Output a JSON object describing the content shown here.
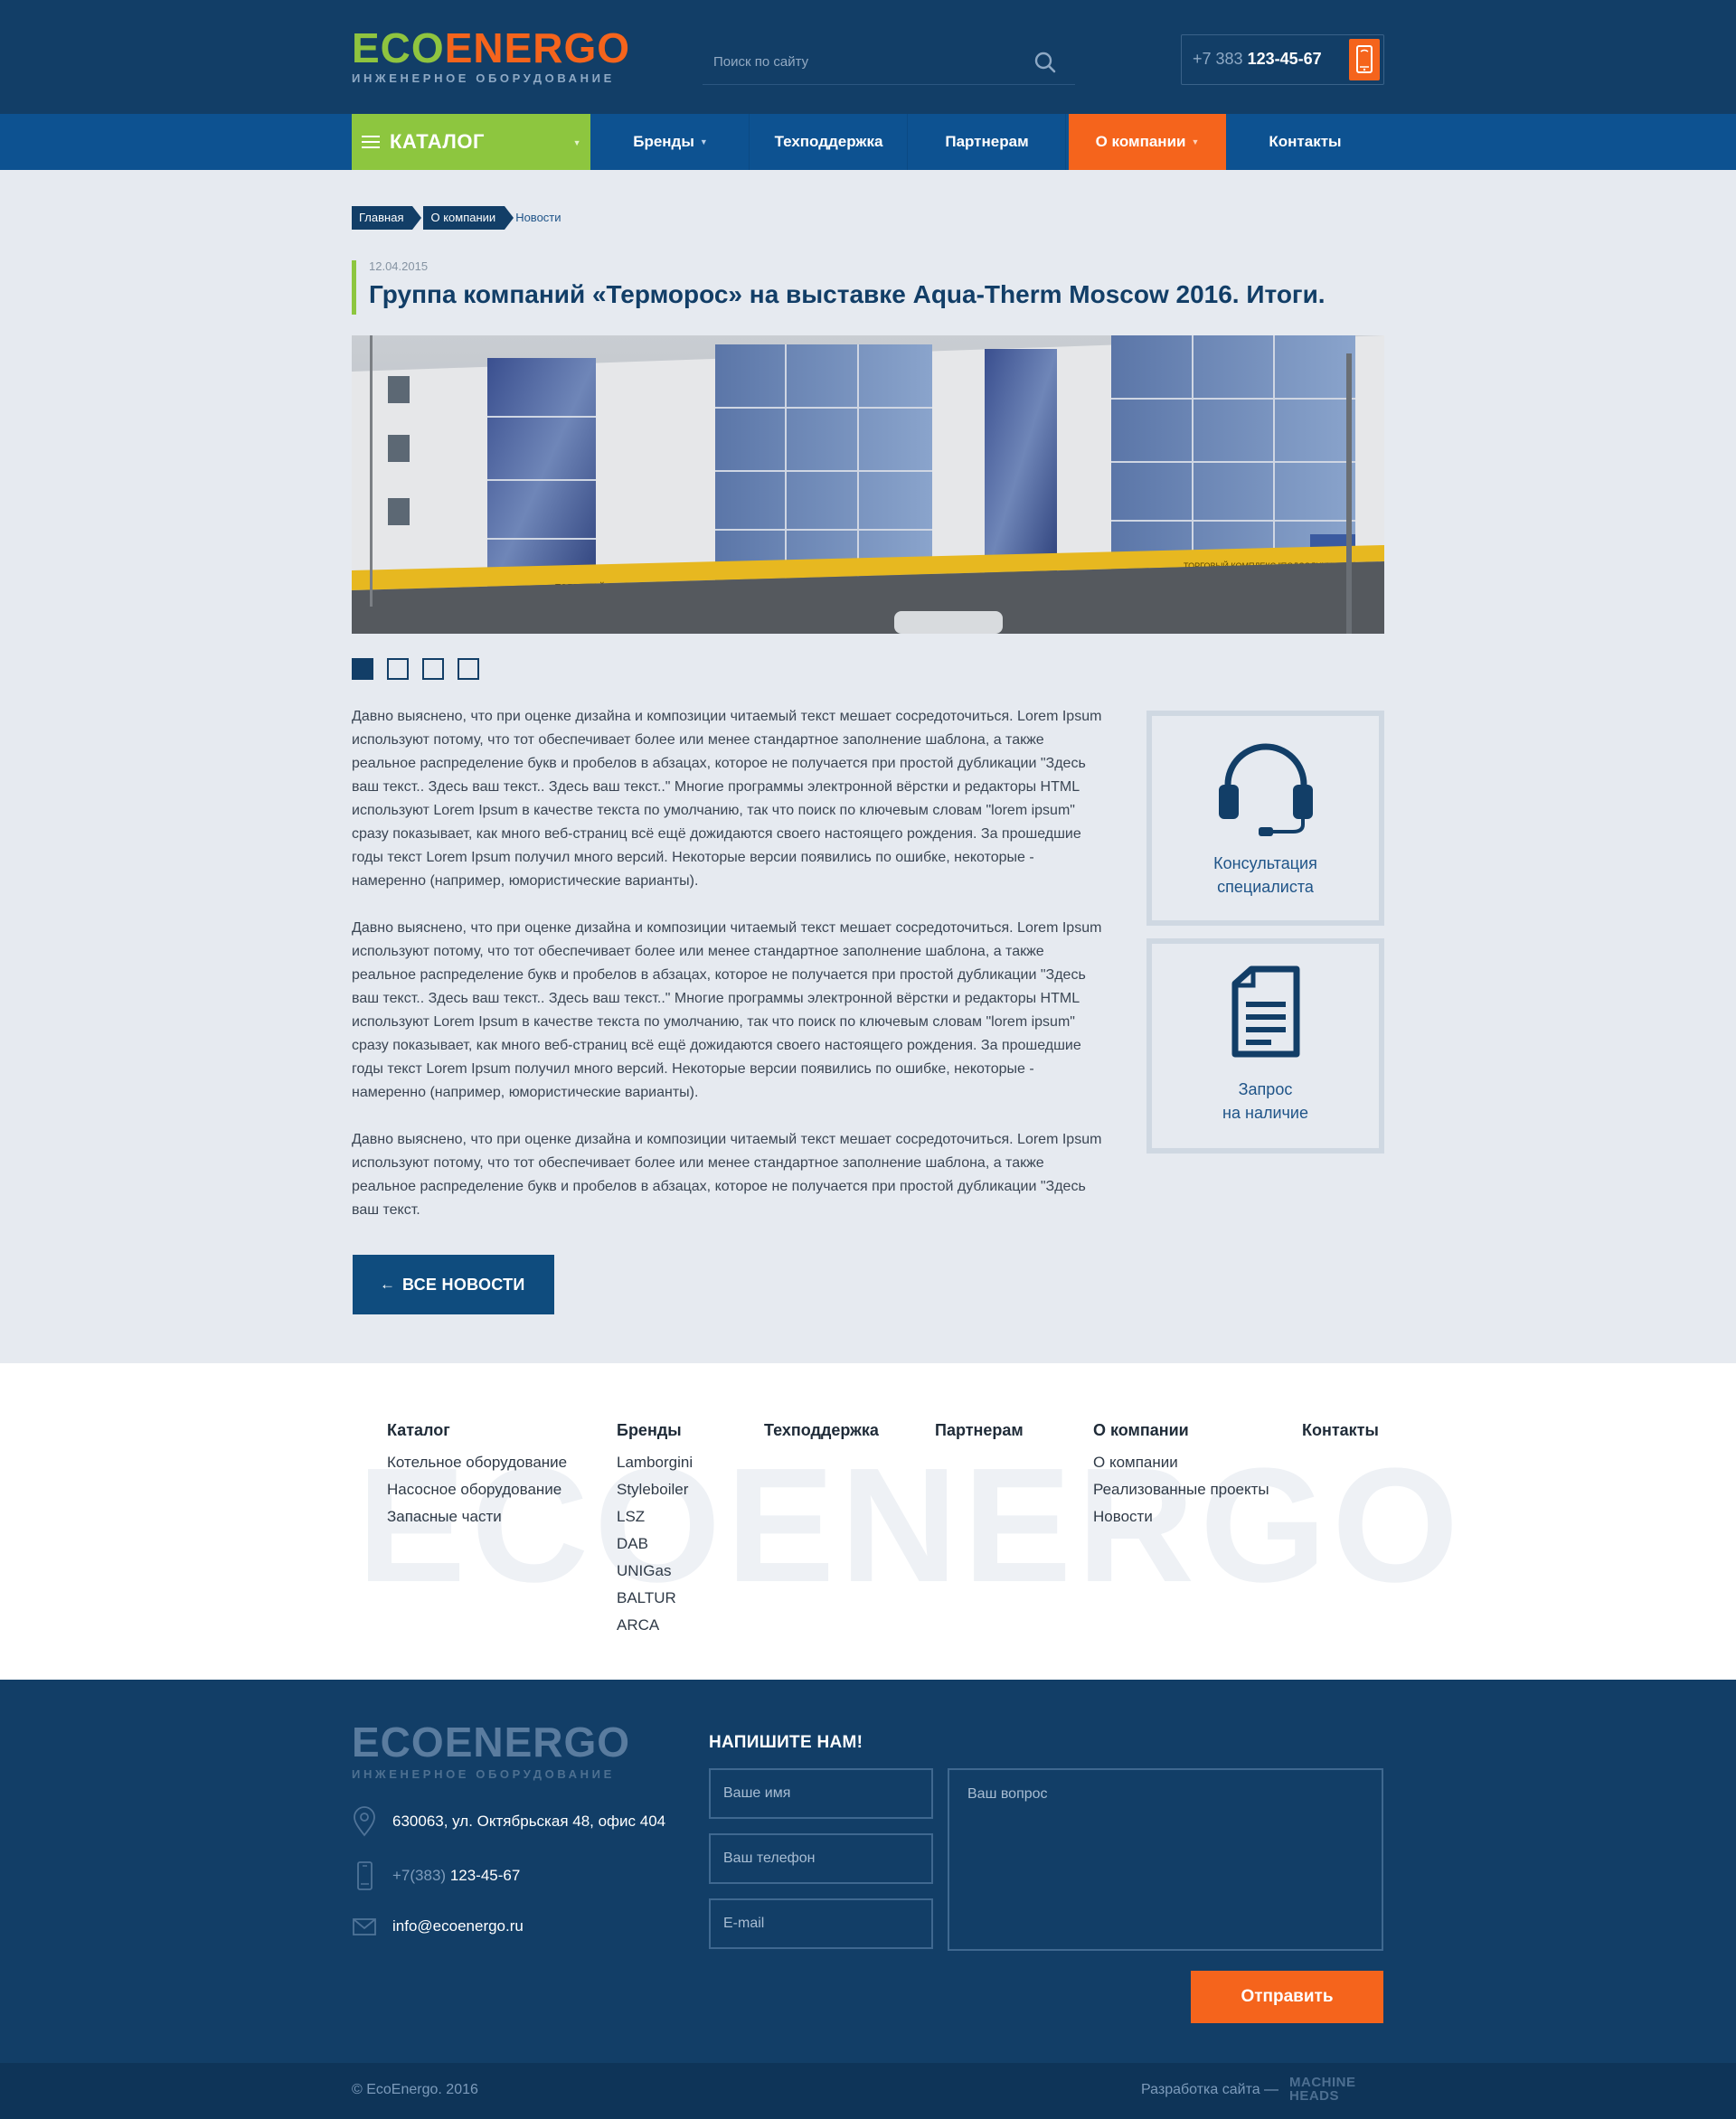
{
  "header": {
    "logo": {
      "eco": "ECO",
      "energo": "ENERGO",
      "tagline": "ИНЖЕНЕРНОЕ ОБОРУДОВАНИЕ"
    },
    "search": {
      "placeholder": "Поиск по сайту",
      "icon": "search-icon"
    },
    "phone": {
      "prefix": "+7 383",
      "number": "123-45-67",
      "icon": "phone-icon"
    }
  },
  "nav": {
    "catalog": "КАТАЛОГ",
    "items": [
      {
        "label": "Бренды",
        "dropdown": true
      },
      {
        "label": "Техподдержка",
        "dropdown": false
      },
      {
        "label": "Партнерам",
        "dropdown": false
      },
      {
        "label": "О компании",
        "dropdown": true,
        "active": true
      },
      {
        "label": "Контакты",
        "dropdown": false
      }
    ]
  },
  "breadcrumbs": [
    "Главная",
    "О компании",
    "Новости"
  ],
  "post": {
    "date": "12.04.2015",
    "title": "Группа компаний «Терморос» на выставке Aqua-Therm Moscow 2016. Итоги.",
    "slider": {
      "count": 4,
      "active": 1,
      "photo_sign_1": "ТОРГОВЫЙ КОМПЛЕКС \"ПОДСОЛНУХ\"",
      "photo_sign_2": "ТОРГОВЫЙ КОМПЛЕКС \"ПОДСОЛНУХ\""
    },
    "paragraphs": [
      "Давно выяснено, что при оценке дизайна и композиции читаемый текст мешает сосредоточиться. Lorem Ipsum используют потому, что тот обеспечивает более или менее стандартное заполнение шаблона, а также реальное распределение букв и пробелов в абзацах, которое не получается при простой дубликации \"Здесь ваш текст.. Здесь ваш текст.. Здесь ваш текст..\" Многие программы электронной вёрстки и редакторы HTML используют Lorem Ipsum в качестве текста по умолчанию, так что поиск по ключевым словам \"lorem ipsum\" сразу показывает, как много веб-страниц всё ещё дожидаются своего настоящего рождения. За прошедшие годы текст Lorem Ipsum получил много версий. Некоторые версии появились по ошибке, некоторые - намеренно (например, юмористические варианты).",
      "Давно выяснено, что при оценке дизайна и композиции читаемый текст мешает сосредоточиться. Lorem Ipsum используют потому, что тот обеспечивает более или менее стандартное заполнение шаблона, а также реальное распределение букв и пробелов в абзацах, которое не получается при простой дубликации \"Здесь ваш текст.. Здесь ваш текст.. Здесь ваш текст..\" Многие программы электронной вёрстки и редакторы HTML используют Lorem Ipsum в качестве текста по умолчанию, так что поиск по ключевым словам \"lorem ipsum\" сразу показывает, как много веб-страниц всё ещё дожидаются своего настоящего рождения. За прошедшие годы текст Lorem Ipsum получил много версий. Некоторые версии появились по ошибке, некоторые - намеренно (например, юмористические варианты).",
      "Давно выяснено, что при оценке дизайна и композиции читаемый текст мешает сосредоточиться. Lorem Ipsum используют потому, что тот обеспечивает более или менее стандартное заполнение шаблона, а также реальное распределение букв и пробелов в абзацах, которое не получается при простой дубликации \"Здесь ваш текст."
    ],
    "back_button": "ВСЕ НОВОСТИ"
  },
  "side": {
    "consult": {
      "line1": "Консультация",
      "line2": "специалиста",
      "icon": "headset-icon"
    },
    "request": {
      "line1": "Запрос",
      "line2": "на наличие",
      "icon": "document-icon"
    }
  },
  "footer_nav": {
    "watermark": "ECOENERGO",
    "columns": [
      {
        "title": "Каталог",
        "links": [
          "Котельное оборудование",
          "Насосное оборудование",
          "Запасные части"
        ]
      },
      {
        "title": "Бренды",
        "links": [
          "Lamborgini",
          "Styleboiler",
          "LSZ",
          "DAB",
          "UNIGas",
          "BALTUR",
          "ARCA"
        ]
      },
      {
        "title": "Техподдержка",
        "links": []
      },
      {
        "title": "Партнерам",
        "links": []
      },
      {
        "title": "О компании",
        "links": [
          "О компании",
          "Реализованные проекты",
          "Новости"
        ]
      },
      {
        "title": "Контакты",
        "links": []
      }
    ]
  },
  "footer": {
    "logo": {
      "eco": "ECO",
      "energo": "ENERGO",
      "tagline": "ИНЖЕНЕРНОЕ ОБОРУДОВАНИЕ"
    },
    "address": "630063, ул. Октябрьская 48, офис 404",
    "phone_prefix": "+7(383)",
    "phone_number": "123-45-67",
    "email": "info@ecoenergo.ru",
    "form": {
      "title": "НАПИШИТЕ НАМ!",
      "name_placeholder": "Ваше имя",
      "phone_placeholder": "Ваш телефон",
      "email_placeholder": "E-mail",
      "question_placeholder": "Ваш вопрос",
      "submit": "Отправить"
    }
  },
  "bottom": {
    "copyright": "© EcoEnergo. 2016",
    "developer_label": "Разработка сайта —",
    "developer_line1": "MACHINE",
    "developer_line2": "HEADS"
  },
  "colors": {
    "brand_dark": "#123e67",
    "nav_blue": "#0d5291",
    "green": "#8dc63f",
    "orange": "#f5641c"
  }
}
